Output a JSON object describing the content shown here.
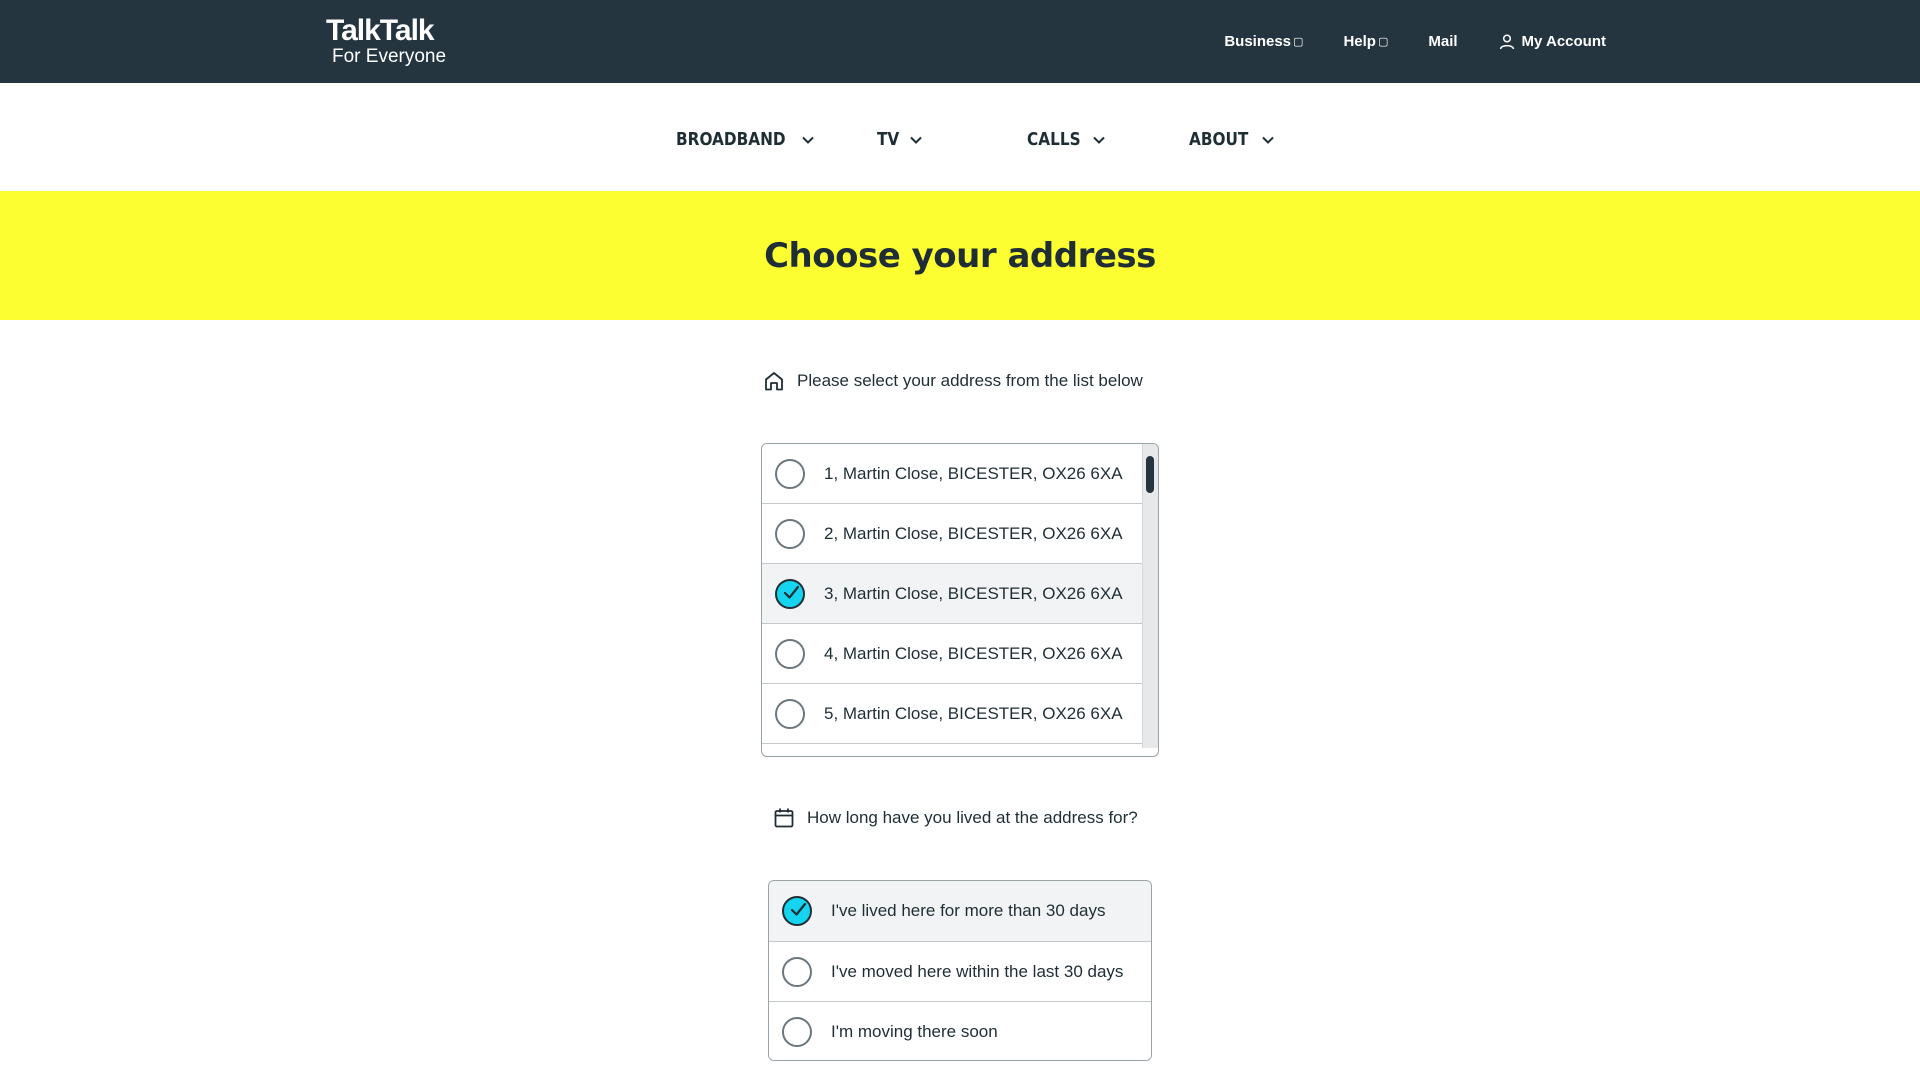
{
  "brand": {
    "name": "TalkTalk",
    "tagline": "For Everyone"
  },
  "topnav": {
    "business": "Business",
    "help": "Help",
    "mail": "Mail",
    "account": "My Account"
  },
  "mainnav": {
    "broadband": "BROADBAND",
    "tv": "TV",
    "calls": "CALLS",
    "about": "ABOUT"
  },
  "hero": {
    "title": "Choose your address"
  },
  "address_section": {
    "prompt": "Please select your address from the list below",
    "items": [
      {
        "label": "1, Martin Close, BICESTER, OX26 6XA",
        "selected": false
      },
      {
        "label": "2, Martin Close, BICESTER, OX26 6XA",
        "selected": false
      },
      {
        "label": "3, Martin Close, BICESTER, OX26 6XA",
        "selected": true
      },
      {
        "label": "4, Martin Close, BICESTER, OX26 6XA",
        "selected": false
      },
      {
        "label": "5, Martin Close, BICESTER, OX26 6XA",
        "selected": false
      }
    ]
  },
  "duration_section": {
    "prompt": "How long have you lived at the address for?",
    "options": [
      {
        "label": "I've lived here for more than 30 days",
        "selected": true
      },
      {
        "label": "I've moved here within the last 30 days",
        "selected": false
      },
      {
        "label": "I'm moving there soon",
        "selected": false
      }
    ]
  },
  "colors": {
    "header_bg": "#243540",
    "hero_bg": "#fdfe32",
    "accent_check": "#15d4ef",
    "text_dark": "#1f2e35"
  }
}
